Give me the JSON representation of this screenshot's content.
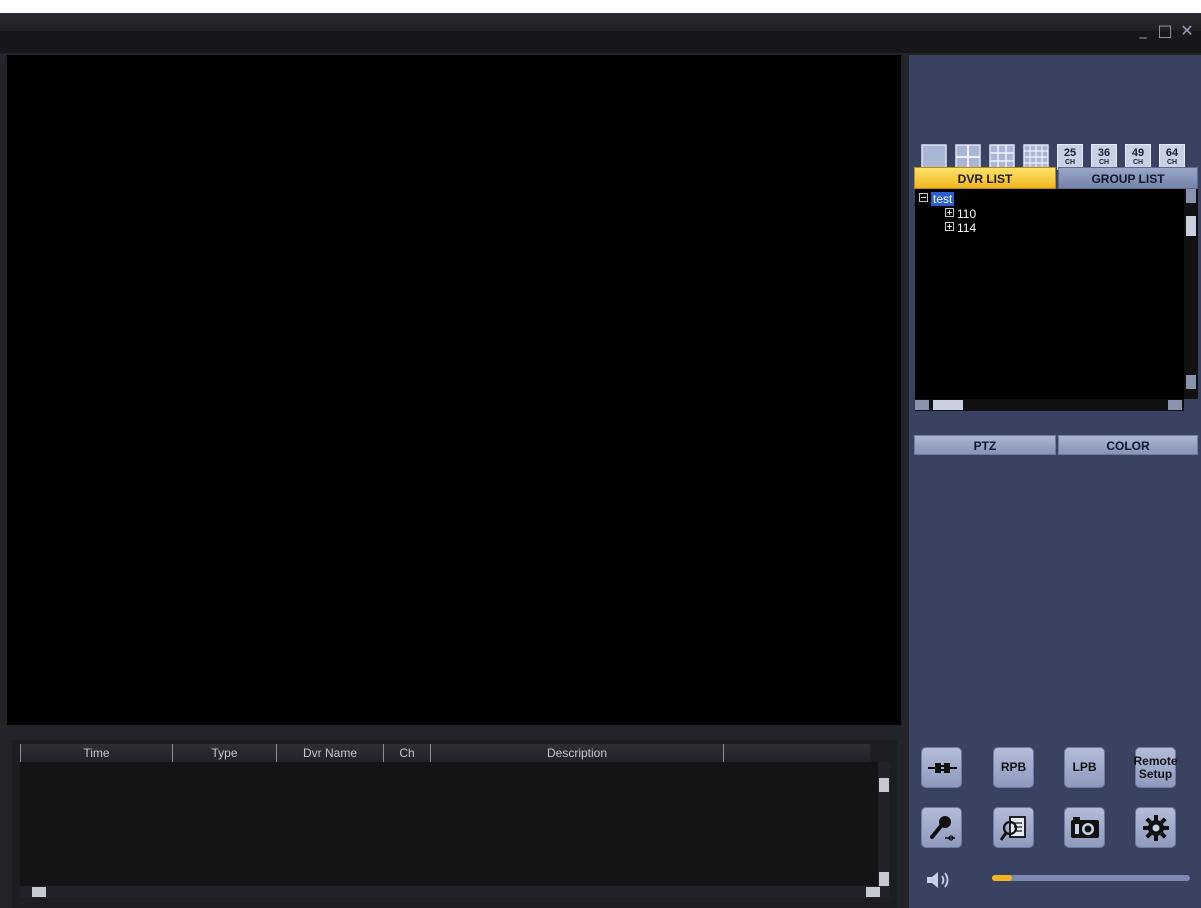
{
  "window": {
    "minimize_glyph": "_",
    "maximize_glyph": "□",
    "close_glyph": "✕"
  },
  "layouts": [
    {
      "name": "layout-1ch-button",
      "label": ""
    },
    {
      "name": "layout-4ch-button",
      "label": ""
    },
    {
      "name": "layout-9ch-button",
      "label": ""
    },
    {
      "name": "layout-16ch-button",
      "label": ""
    },
    {
      "name": "layout-25ch-button",
      "label": "25"
    },
    {
      "name": "layout-36ch-button",
      "label": "36"
    },
    {
      "name": "layout-49ch-button",
      "label": "49"
    },
    {
      "name": "layout-64ch-button",
      "label": "64"
    }
  ],
  "layout_sub": "CH",
  "tabs": {
    "dvr_list": "DVR LIST",
    "group_list": "GROUP LIST"
  },
  "tree": {
    "root": "test",
    "children": [
      "110",
      "114"
    ]
  },
  "panel_tabs": {
    "ptz": "PTZ",
    "color": "COLOR"
  },
  "actions": {
    "connect_icon": "plug-icon",
    "rpb": "RPB",
    "lpb": "LPB",
    "remote_setup_line1": "Remote",
    "remote_setup_line2": "Setup",
    "mic_icon": "microphone-icon",
    "search_icon": "document-search-icon",
    "camera_icon": "camera-icon",
    "settings_icon": "gear-icon"
  },
  "volume": {
    "icon": "speaker-icon",
    "level": 0.1
  },
  "log": {
    "columns": [
      "Time",
      "Type",
      "Dvr Name",
      "Ch",
      "Description",
      ""
    ]
  },
  "colors": {
    "accent": "#f2b41e",
    "panel": "#3a4262",
    "tree_selection": "#2b5fcf"
  }
}
